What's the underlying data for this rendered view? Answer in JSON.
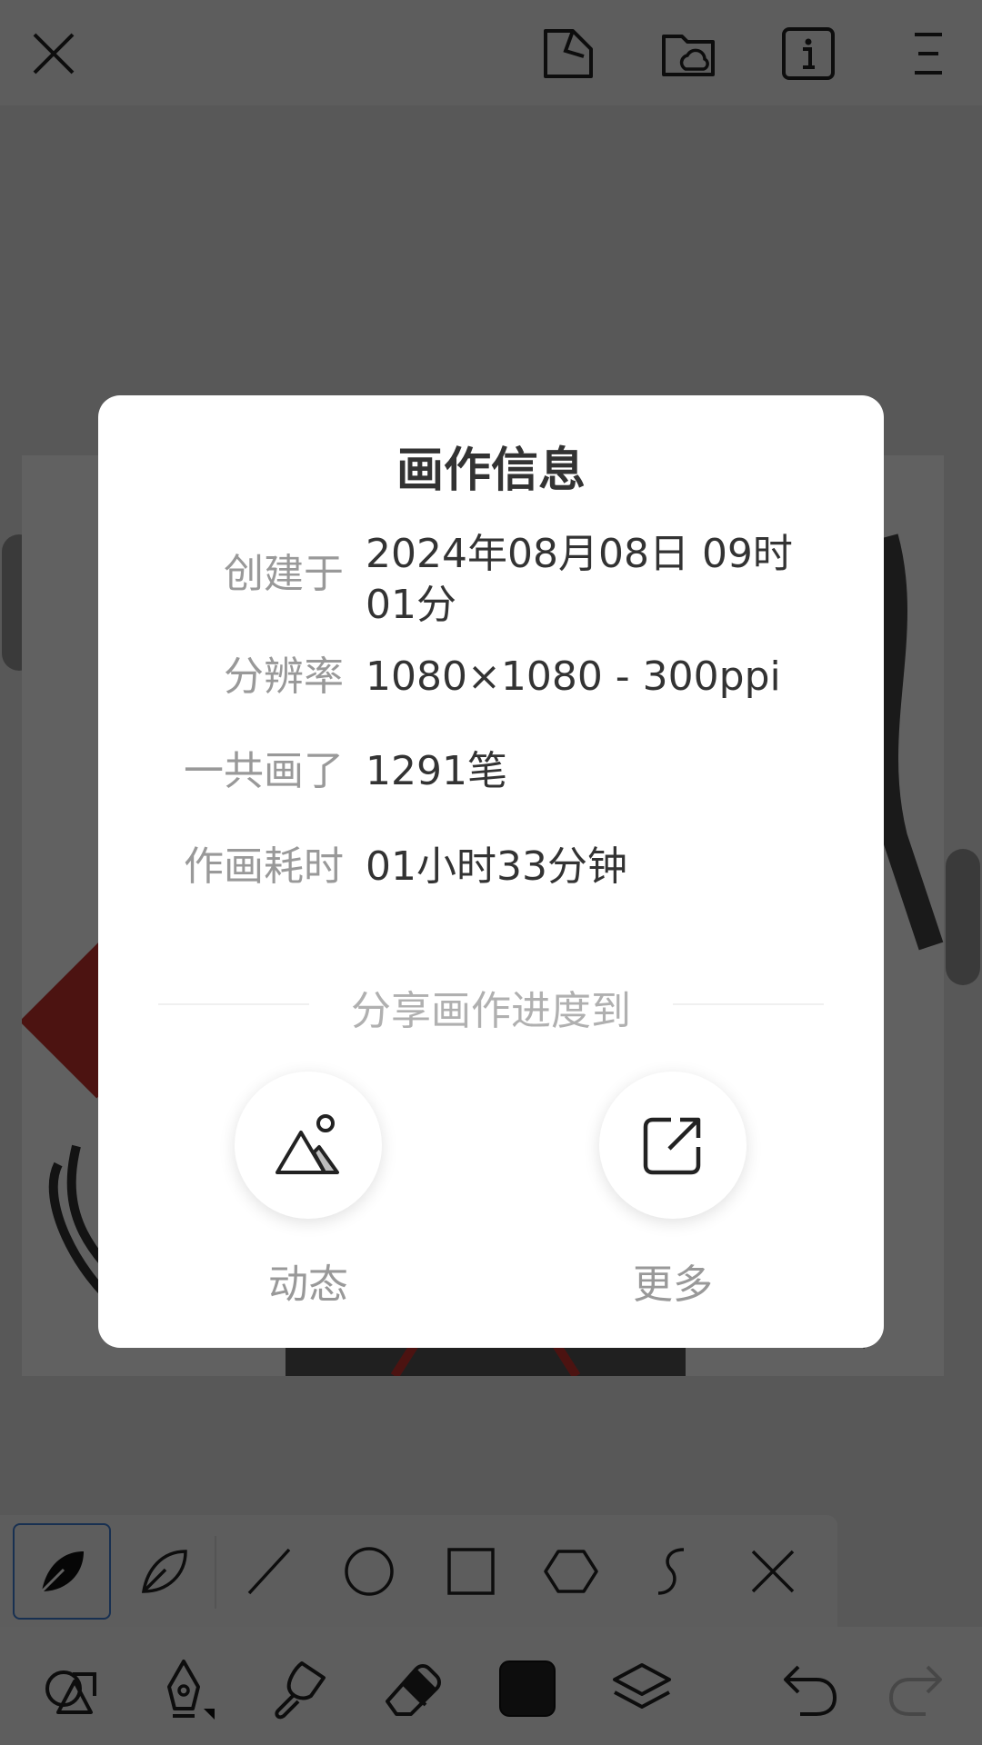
{
  "dialog": {
    "title": "画作信息",
    "rows": [
      {
        "label": "创建于",
        "value_line1": "2024年08月08日 09时",
        "value_line2": "01分"
      },
      {
        "label": "分辨率",
        "value": "1080×1080 - 300ppi"
      },
      {
        "label": "一共画了",
        "value": "1291笔"
      },
      {
        "label": "作画耗时",
        "value": "01小时33分钟"
      }
    ],
    "share_heading": "分享画作进度到",
    "share_options": [
      {
        "label": "动态",
        "icon": "mountain-sun-icon"
      },
      {
        "label": "更多",
        "icon": "external-share-icon"
      }
    ]
  },
  "topbar": {
    "icons": [
      "close-icon",
      "save-icon",
      "cloud-folder-icon",
      "info-icon",
      "menu-icon"
    ]
  },
  "shape_tools": [
    "freehand-brush-icon",
    "leaf-outline-icon",
    "line-icon",
    "circle-icon",
    "rectangle-icon",
    "hexagon-icon",
    "curve-icon",
    "close-shape-icon"
  ],
  "bottom_tools": [
    "shapes-icon",
    "pen-tool-icon",
    "smudge-icon",
    "eraser-icon",
    "color-swatch",
    "layers-icon",
    "undo-icon",
    "redo-icon"
  ],
  "colors": {
    "accent": "#3f7fd6",
    "swatch": "#222222",
    "dialog_bg": "#ffffff",
    "overlay": "rgba(0,0,0,0.62)"
  }
}
